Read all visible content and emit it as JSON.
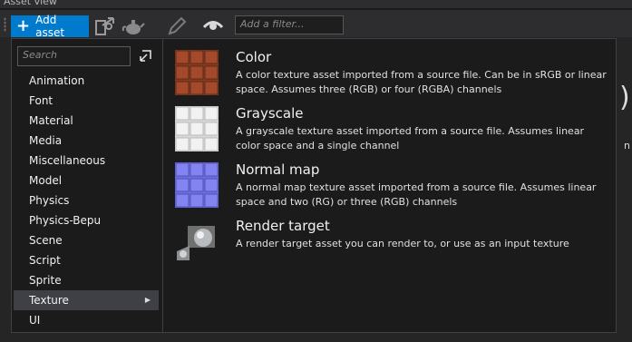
{
  "window": {
    "title": "Asset view"
  },
  "toolbar": {
    "add_asset_label": "Add asset",
    "filter_placeholder": "Add a filter...",
    "icons": [
      "import-icon",
      "teapot-icon",
      "pencil-icon",
      "eye-icon"
    ]
  },
  "search": {
    "placeholder": "Search"
  },
  "categories": [
    {
      "label": "Animation"
    },
    {
      "label": "Font"
    },
    {
      "label": "Material"
    },
    {
      "label": "Media"
    },
    {
      "label": "Miscellaneous"
    },
    {
      "label": "Model"
    },
    {
      "label": "Physics"
    },
    {
      "label": "Physics-Bepu"
    },
    {
      "label": "Scene"
    },
    {
      "label": "Script"
    },
    {
      "label": "Sprite"
    },
    {
      "label": "Texture",
      "selected": true,
      "has_submenu": true
    },
    {
      "label": "UI"
    }
  ],
  "assets": [
    {
      "name": "Color",
      "description": "A color texture asset imported from a source file. Can be in sRGB or linear space. Assumes three (RGB) or four (RGBA) channels"
    },
    {
      "name": "Grayscale",
      "description": "A grayscale texture asset imported from a source file. Assumes linear color space and a single channel"
    },
    {
      "name": "Normal map",
      "description": "A normal map texture asset imported from a source file. Assumes linear space and two (RG) or three (RGB) channels"
    },
    {
      "name": "Render target",
      "description": "A render target asset you can render to, or use as an input texture"
    }
  ],
  "colors": {
    "accent": "#007acc",
    "background": "#1b1b1c",
    "selected": "#3f3f46"
  }
}
